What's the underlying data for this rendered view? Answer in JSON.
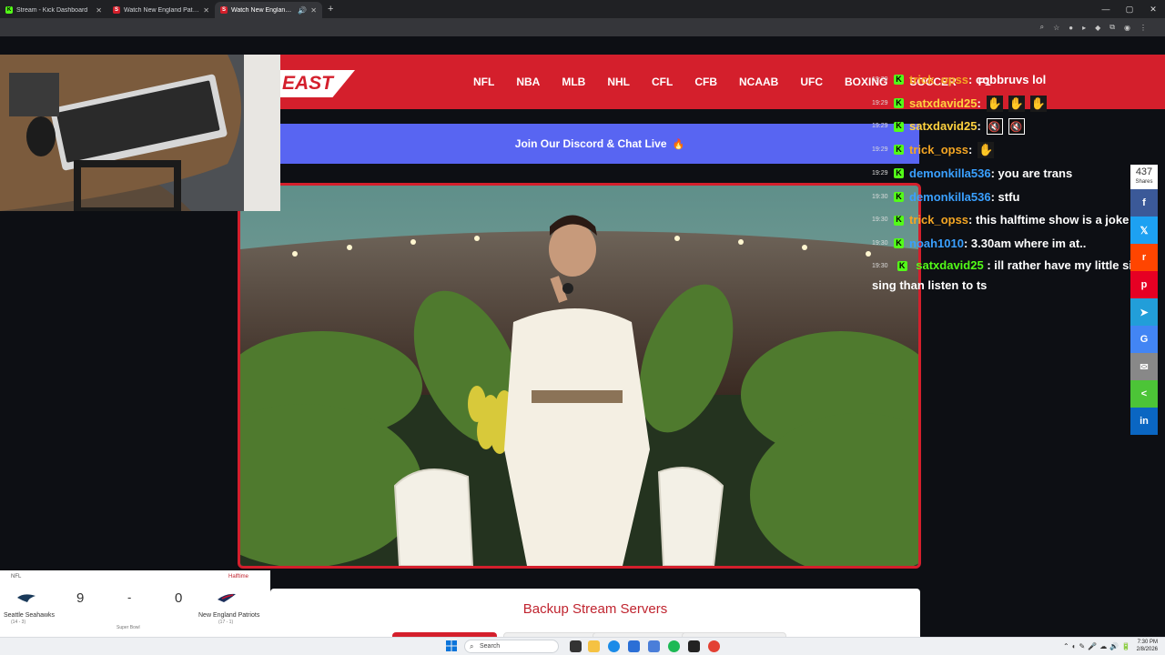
{
  "browser": {
    "tabs": [
      {
        "title": "Stream - Kick Dashboard",
        "favicon": "kick-icon",
        "active": false
      },
      {
        "title": "Watch New England Patriots v...",
        "favicon": "streameast-icon",
        "active": false
      },
      {
        "title": "Watch New England Patrio...",
        "favicon": "streameast-icon",
        "active": true
      }
    ],
    "new_tab_label": "+"
  },
  "site": {
    "logo_text": "EAST",
    "nav": [
      "NFL",
      "NBA",
      "MLB",
      "NHL",
      "CFL",
      "CFB",
      "NCAAB",
      "UFC",
      "BOXING",
      "SOCCER",
      "F1"
    ],
    "discord_banner": "Join Our Discord & Chat Live",
    "discord_emoji": "🔥",
    "backup_title": "Backup Stream Servers",
    "accent_color": "#d41f2c",
    "discord_color": "#5865f2"
  },
  "chat": [
    {
      "time": "19:29",
      "user": "trick_opss",
      "color": "#f5a623",
      "text": ": cobbruvs lol",
      "emotes": []
    },
    {
      "time": "19:29",
      "user": "satxdavid25",
      "color": "#ffd23f",
      "text": ": ",
      "emotes": [
        "hand",
        "hand",
        "hand"
      ]
    },
    {
      "time": "19:29",
      "user": "satxdavid25",
      "color": "#ffd23f",
      "text": ": ",
      "emotes": [
        "mute",
        "mute"
      ]
    },
    {
      "time": "19:29",
      "user": "trick_opss",
      "color": "#f5a623",
      "text": ": ",
      "emotes": [
        "hand"
      ]
    },
    {
      "time": "19:29",
      "user": "demonkilla536",
      "color": "#3aa0ff",
      "text": ": you are trans",
      "emotes": []
    },
    {
      "time": "19:30",
      "user": "demonkilla536",
      "color": "#3aa0ff",
      "text": ": stfu",
      "emotes": []
    },
    {
      "time": "19:30",
      "user": "trick_opss",
      "color": "#f5a623",
      "text": ": this halftime show is a joke",
      "emotes": []
    },
    {
      "time": "19:30",
      "user": "noah1010",
      "color": "#3aa0ff",
      "text": ": 3.30am where im at..",
      "emotes": []
    },
    {
      "time": "19:30",
      "user": "satxdavid25",
      "color": "#53fc18",
      "text": ": ill rather have my little sister sing than listen to ts",
      "emotes": []
    }
  ],
  "share": {
    "count": "437",
    "count_label": "Shares",
    "buttons": [
      {
        "name": "facebook",
        "label": "f",
        "color": "#3b5998"
      },
      {
        "name": "twitter",
        "label": "𝕏",
        "color": "#1da1f2"
      },
      {
        "name": "reddit",
        "label": "r",
        "color": "#ff4500"
      },
      {
        "name": "pinterest",
        "label": "p",
        "color": "#e60023"
      },
      {
        "name": "telegram",
        "label": "➤",
        "color": "#229ed9"
      },
      {
        "name": "google",
        "label": "G",
        "color": "#4285f4"
      },
      {
        "name": "email",
        "label": "✉",
        "color": "#888888"
      },
      {
        "name": "sharethis",
        "label": "<",
        "color": "#4cc437"
      },
      {
        "name": "linkedin",
        "label": "in",
        "color": "#0a66c2"
      }
    ]
  },
  "scoreboard": {
    "league": "NFL",
    "status": "Halftime",
    "home_team": "Seattle Seahawks",
    "home_record": "(14 - 3)",
    "home_score": "9",
    "away_team": "New England Patriots",
    "away_record": "(17 - 1)",
    "away_score": "0",
    "separator": "-",
    "event": "Super Bowl"
  },
  "taskbar": {
    "search_placeholder": "Search",
    "time": "7:30 PM",
    "date": "2/8/2026"
  }
}
